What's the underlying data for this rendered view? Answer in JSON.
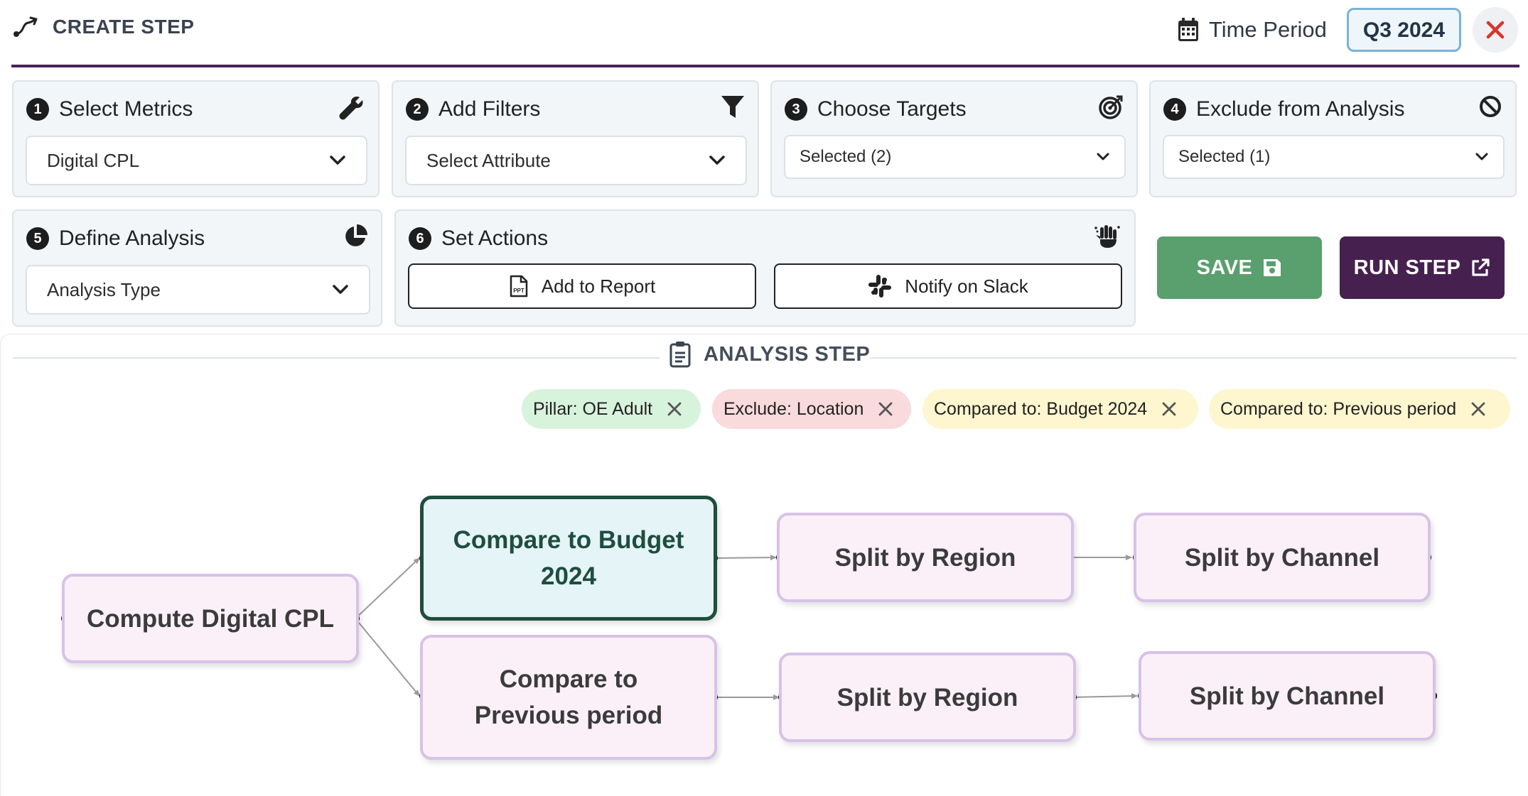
{
  "header": {
    "title": "CREATE STEP",
    "time_period_label": "Time Period",
    "time_period_value": "Q3 2024"
  },
  "cards": {
    "metrics": {
      "number": "1",
      "title": "Select Metrics",
      "value": "Digital CPL"
    },
    "filters": {
      "number": "2",
      "title": "Add Filters",
      "placeholder": "Select Attribute"
    },
    "targets": {
      "number": "3",
      "title": "Choose Targets",
      "value": "Selected (2)"
    },
    "exclude": {
      "number": "4",
      "title": "Exclude from Analysis",
      "value": "Selected (1)"
    },
    "analysis": {
      "number": "5",
      "title": "Define Analysis",
      "placeholder": "Analysis Type"
    },
    "actions": {
      "number": "6",
      "title": "Set Actions",
      "add_report": "Add to Report",
      "notify_slack": "Notify on Slack"
    }
  },
  "buttons": {
    "save": "SAVE",
    "run": "RUN STEP"
  },
  "analysis_step": {
    "title": "ANALYSIS STEP",
    "chips": [
      {
        "label": "Pillar: OE Adult",
        "color": "#d8f3dc"
      },
      {
        "label": "Exclude: Location",
        "color": "#f9dadd"
      },
      {
        "label": "Compared to: Budget 2024",
        "color": "#fdf6cf"
      },
      {
        "label": "Compared to: Previous period",
        "color": "#fdf6cf"
      }
    ],
    "nodes": {
      "root": "Compute Digital CPL",
      "budget_line1": "Compare to Budget",
      "budget_line2": "2024",
      "previous_line1": "Compare to",
      "previous_line2": "Previous period",
      "region_top": "Split by Region",
      "channel_top": "Split by Channel",
      "region_bottom": "Split by Region",
      "channel_bottom": "Split by Channel"
    }
  },
  "colors": {
    "accent": "#4a235a",
    "save": "#5a9f6e",
    "run": "#46204f",
    "node_fill": "#fbf0f7",
    "node_border": "#d8c2e8",
    "active_fill": "#e4f4f7",
    "active_border": "#1f4d3e",
    "close": "#d9342b"
  }
}
